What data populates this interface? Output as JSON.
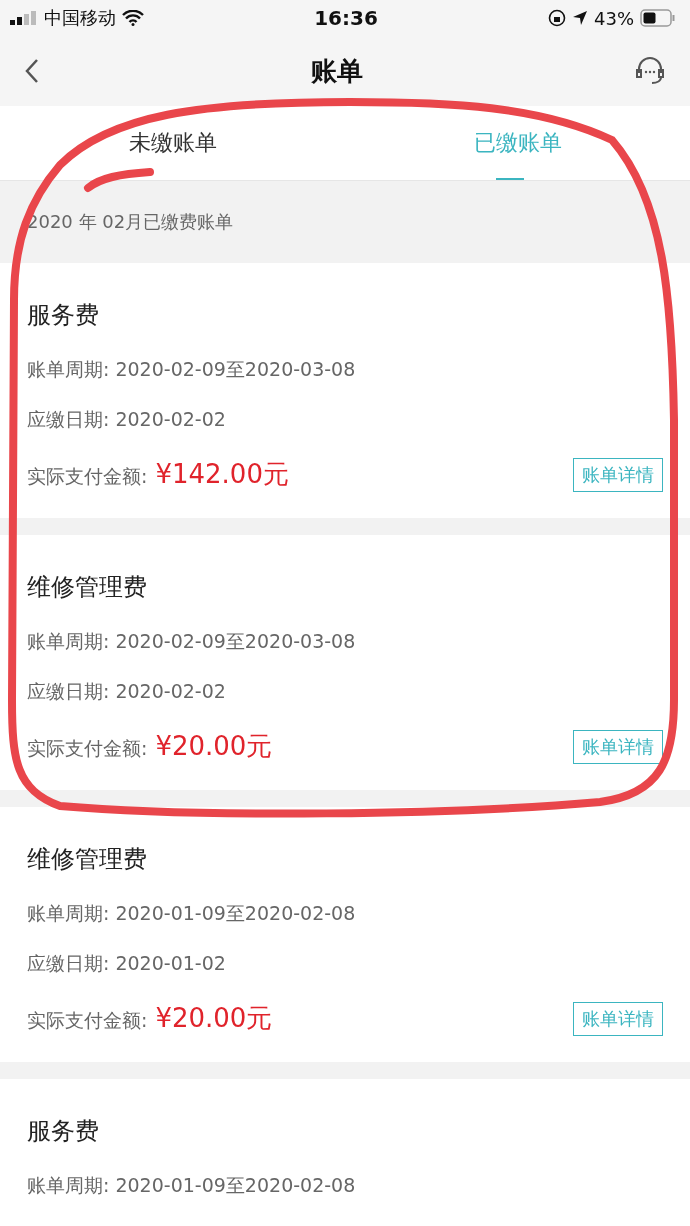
{
  "status_bar": {
    "carrier": "中国移动",
    "time": "16:36",
    "battery": "43%"
  },
  "nav": {
    "title": "账单"
  },
  "tabs": [
    {
      "label": "未缴账单",
      "selected": false
    },
    {
      "label": "已缴账单",
      "selected": true
    }
  ],
  "section_title": "2020 年 02月已缴费账单",
  "bills": [
    {
      "title": "服务费",
      "period": "账单周期: 2020-02-09至2020-03-08",
      "due": "应缴日期: 2020-02-02",
      "paid_label": "实际支付金额:",
      "amount": "¥142.00元",
      "button": "账单详情"
    },
    {
      "title": "维修管理费",
      "period": "账单周期: 2020-02-09至2020-03-08",
      "due": "应缴日期: 2020-02-02",
      "paid_label": "实际支付金额:",
      "amount": "¥20.00元",
      "button": "账单详情"
    },
    {
      "title": "维修管理费",
      "period": "账单周期: 2020-01-09至2020-02-08",
      "due": "应缴日期: 2020-01-02",
      "paid_label": "实际支付金额:",
      "amount": "¥20.00元",
      "button": "账单详情"
    },
    {
      "title": "服务费",
      "period": "账单周期: 2020-01-09至2020-02-08"
    }
  ]
}
